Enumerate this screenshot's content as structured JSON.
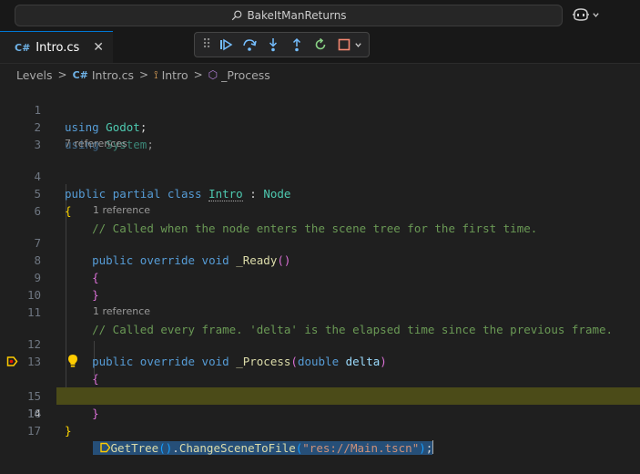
{
  "title_bar": {
    "search_text": "BakeItManReturns"
  },
  "tab": {
    "icon": "C#",
    "label": "Intro.cs",
    "close": "✕"
  },
  "debug_toolbar": {
    "icons": [
      "grip-icon",
      "continue-icon",
      "step-over-icon",
      "step-into-icon",
      "step-out-icon",
      "restart-icon",
      "stop-icon",
      "chevron-down-icon"
    ]
  },
  "breadcrumb": {
    "items": [
      "Levels",
      "Intro.cs",
      "Intro",
      "_Process"
    ],
    "separator": ">"
  },
  "editor": {
    "line_numbers": [
      "1",
      "2",
      "3",
      "4",
      "5",
      "6",
      "7",
      "8",
      "9",
      "10",
      "11",
      "12",
      "13",
      "14",
      "15",
      "16",
      "17"
    ],
    "current_line": "14",
    "codelens": {
      "l4": "7 references",
      "l7": "1 reference",
      "l12": "1 reference"
    },
    "tokens": {
      "using": "using",
      "godot": "Godot",
      "system": "System",
      "semi": ";",
      "public": "public",
      "partial": "partial",
      "class": "class",
      "intro": "Intro",
      "colon": ":",
      "node": "Node",
      "lbrace": "{",
      "rbrace": "}",
      "comment6": "// Called when the node enters the scene tree for the first time.",
      "override": "override",
      "void": "void",
      "ready": "_Ready",
      "parens": "()",
      "comment11": "// Called every frame. 'delta' is the elapsed time since the previous frame.",
      "process": "_Process",
      "lparen": "(",
      "rparen": ")",
      "double": "double",
      "delta": "delta",
      "gettree": "GetTree",
      "dot": ".",
      "changescene": "ChangeSceneToFile",
      "path": "\"res://Main.tscn\""
    }
  },
  "colors": {
    "accent": "#0078d4",
    "current_line_bg": "#4b4b18",
    "breakpoint_arrow": "#ffcc00"
  }
}
